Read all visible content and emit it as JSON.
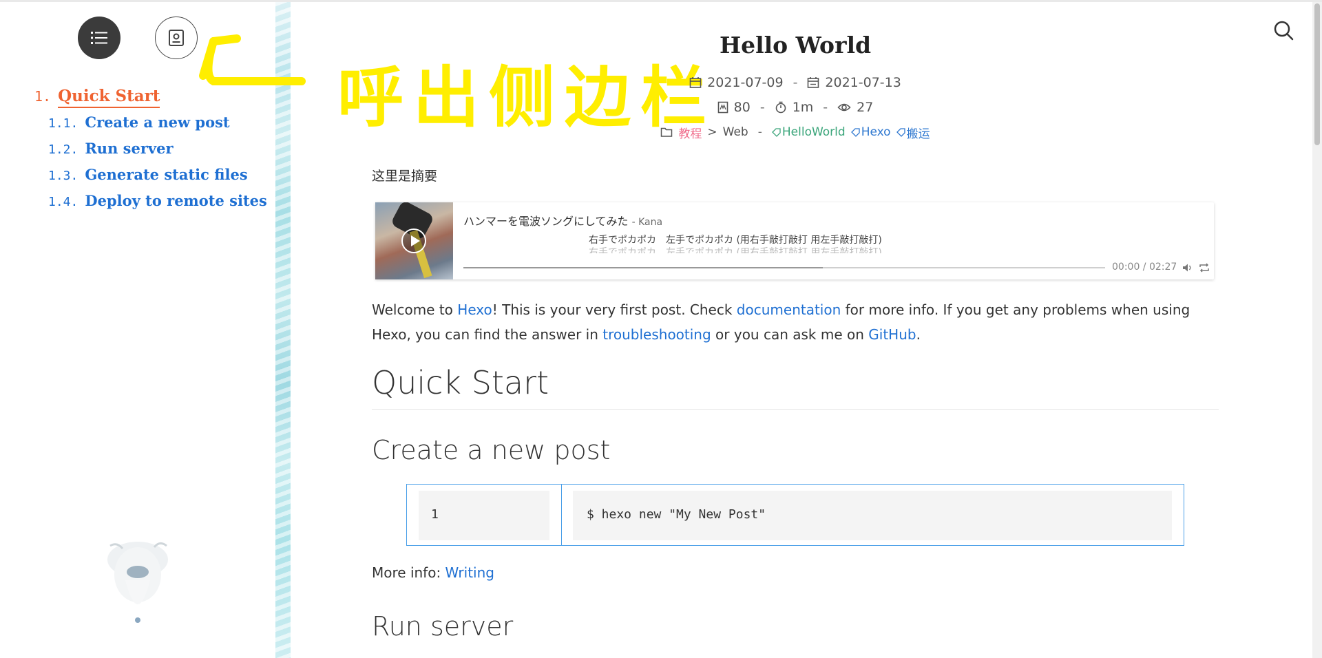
{
  "sidebar": {
    "toc_button_icon": "list-icon",
    "overview_button_icon": "profile-card-icon",
    "toc": [
      {
        "num": "1.",
        "label": "Quick Start",
        "active": true
      },
      {
        "num": "1.1.",
        "label": "Create a new post"
      },
      {
        "num": "1.2.",
        "label": "Run server"
      },
      {
        "num": "1.3.",
        "label": "Generate static files"
      },
      {
        "num": "1.4.",
        "label": "Deploy to remote sites"
      }
    ]
  },
  "annotation": {
    "text": "呼出侧边栏",
    "color": "#ffee00"
  },
  "header": {
    "search_icon": "search-icon"
  },
  "post": {
    "title": "Hello World",
    "created": "2021-07-09",
    "updated": "2021-07-13",
    "date_sep": "-",
    "word_count": "80",
    "read_time": "1m",
    "views": "27",
    "category": "教程",
    "category_sep": ">",
    "subcategory": "Web",
    "meta_sep": "-",
    "tags": [
      "HelloWorld",
      "Hexo",
      "搬运"
    ]
  },
  "article": {
    "summary": "这里是摘要",
    "player": {
      "song_title": "ハンマーを電波ソングにしてみた",
      "artist": "- Kana",
      "lyric_current": "右手でポカポカ　左手でポカポカ (用右手敲打敲打 用左手敲打敲打)",
      "lyric_next": "右手でポカポカ　左手でポカポカ (用右手敲打敲打 用左手敲打敲打)",
      "time": "00:00 / 02:27",
      "loaded_fraction": 0.56
    },
    "intro": {
      "t1": "Welcome to ",
      "link_hexo": "Hexo",
      "t2": "! This is your very first post. Check ",
      "link_docs": "documentation",
      "t3": " for more info. If you get any problems when using Hexo, you can find the answer in ",
      "link_trouble": "troubleshooting",
      "t4": " or you can ask me on ",
      "link_github": "GitHub",
      "t5": "."
    },
    "h_quick_start": "Quick Start",
    "h_create": "Create a new post",
    "code": {
      "line_number": "1",
      "line": "$ hexo new \"My New Post\""
    },
    "more_info_label": "More info: ",
    "more_info_link": "Writing",
    "h_run": "Run server"
  },
  "colors": {
    "link": "#1e6fd2",
    "toc_active": "#ef6331",
    "category": "#f06b8a",
    "tag_green": "#3aa57a",
    "code_border": "#4a9fe8"
  }
}
